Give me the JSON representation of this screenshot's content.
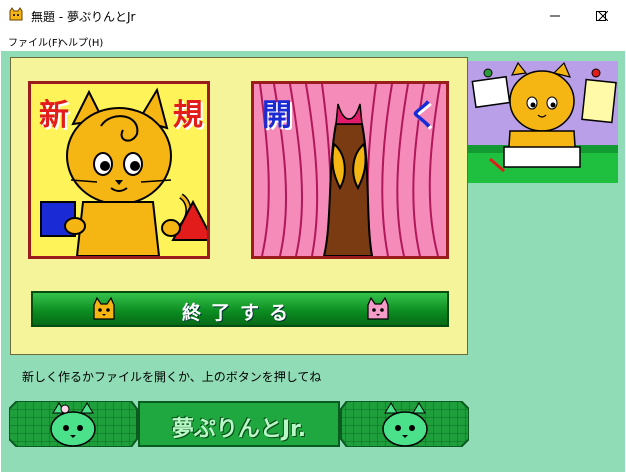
{
  "window": {
    "title": "無題 - 夢ぷりんとJr"
  },
  "menubar": {
    "file": "ファイル(F)",
    "help": "ヘルプ(H)"
  },
  "buttons": {
    "new_label_1": "新",
    "new_label_2": "規",
    "open_label_1": "開",
    "open_label_2": "く",
    "exit_label": "終了する"
  },
  "status": {
    "hint": "新しく作るかファイルを開くか、上のボタンを押してね"
  },
  "banner": {
    "title": "夢ぷりんとJr."
  },
  "colors": {
    "client_bg": "#8fdcb6",
    "panel_bg": "#f6f49a",
    "accent_red": "#e21b1b",
    "accent_blue": "#1a2bd6"
  }
}
